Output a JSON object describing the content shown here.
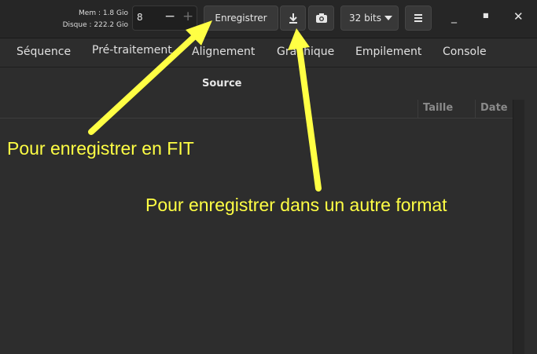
{
  "status": {
    "mem": "Mem : 1.8 Gio",
    "disk": "Disque : 222.2 Gio"
  },
  "threads": {
    "value": "8",
    "minus": "−",
    "plus": "+"
  },
  "toolbar": {
    "save_label": "Enregistrer",
    "bits_label": "32 bits",
    "export_icon": "download-icon",
    "snapshot_icon": "camera-icon",
    "menu_icon": "hamburger-menu-icon"
  },
  "window": {
    "minimize": "_",
    "maximize": "■",
    "close": "✕"
  },
  "tabs": [
    {
      "label": "Séquence"
    },
    {
      "label": "Pré-traitement"
    },
    {
      "label": "Alignement"
    },
    {
      "label": "Graphique"
    },
    {
      "label": "Empilement"
    },
    {
      "label": "Console"
    }
  ],
  "panel": {
    "title": "Source",
    "columns": [
      "Taille",
      "Date"
    ]
  },
  "annotations": {
    "fit": "Pour enregistrer en FIT",
    "other": "Pour enregistrer dans un autre format",
    "color": "#ffff44"
  }
}
